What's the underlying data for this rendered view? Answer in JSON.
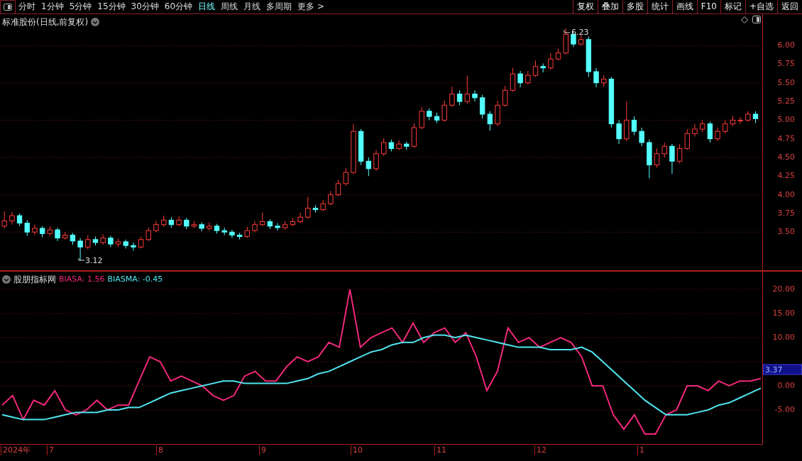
{
  "toolbar": {
    "periods": [
      {
        "label": "分时",
        "selected": false
      },
      {
        "label": "1分钟",
        "selected": false
      },
      {
        "label": "5分钟",
        "selected": false
      },
      {
        "label": "15分钟",
        "selected": false
      },
      {
        "label": "30分钟",
        "selected": false
      },
      {
        "label": "60分钟",
        "selected": false
      },
      {
        "label": "日线",
        "selected": true
      },
      {
        "label": "周线",
        "selected": false
      },
      {
        "label": "月线",
        "selected": false
      },
      {
        "label": "多周期",
        "selected": false
      },
      {
        "label": "更多 >",
        "selected": false
      }
    ],
    "buttons": [
      "复权",
      "叠加",
      "多股",
      "统计",
      "画线",
      "F10",
      "标记",
      "+自选",
      "返回"
    ]
  },
  "price_panel": {
    "title": "标准股份(日线,前复权)",
    "high_label": "6.23",
    "low_label": "3.12",
    "chart_data": {
      "type": "candlestick",
      "grid": true,
      "ylim": [
        2.97,
        6.42
      ],
      "yticks": [
        {
          "value": 6,
          "label": "6.00"
        },
        {
          "value": 5.75,
          "label": "5.75"
        },
        {
          "value": 5.5,
          "label": "5.50"
        },
        {
          "value": 5.25,
          "label": "5.25"
        },
        {
          "value": 5,
          "label": "5.00"
        },
        {
          "value": 4.75,
          "label": "4.75"
        },
        {
          "value": 4.5,
          "label": "4.50"
        },
        {
          "value": 4.25,
          "label": "4.25"
        },
        {
          "value": 4,
          "label": "4.00"
        },
        {
          "value": 3.75,
          "label": "3.75"
        },
        {
          "value": 3.5,
          "label": "3.50"
        }
      ],
      "ohlc": [
        [
          3.58,
          3.78,
          3.55,
          3.65
        ],
        [
          3.65,
          3.77,
          3.6,
          3.72
        ],
        [
          3.72,
          3.75,
          3.58,
          3.62
        ],
        [
          3.62,
          3.66,
          3.45,
          3.5
        ],
        [
          3.5,
          3.6,
          3.46,
          3.55
        ],
        [
          3.55,
          3.58,
          3.43,
          3.48
        ],
        [
          3.48,
          3.58,
          3.45,
          3.53
        ],
        [
          3.53,
          3.56,
          3.38,
          3.42
        ],
        [
          3.42,
          3.5,
          3.4,
          3.46
        ],
        [
          3.46,
          3.49,
          3.33,
          3.38
        ],
        [
          3.38,
          3.42,
          3.12,
          3.3
        ],
        [
          3.3,
          3.46,
          3.27,
          3.4
        ],
        [
          3.4,
          3.44,
          3.32,
          3.36
        ],
        [
          3.36,
          3.47,
          3.33,
          3.42
        ],
        [
          3.42,
          3.45,
          3.3,
          3.34
        ],
        [
          3.34,
          3.41,
          3.3,
          3.37
        ],
        [
          3.37,
          3.4,
          3.28,
          3.32
        ],
        [
          3.32,
          3.36,
          3.25,
          3.3
        ],
        [
          3.3,
          3.44,
          3.28,
          3.4
        ],
        [
          3.4,
          3.56,
          3.38,
          3.52
        ],
        [
          3.52,
          3.65,
          3.5,
          3.6
        ],
        [
          3.6,
          3.72,
          3.57,
          3.66
        ],
        [
          3.66,
          3.7,
          3.56,
          3.6
        ],
        [
          3.6,
          3.71,
          3.58,
          3.66
        ],
        [
          3.66,
          3.69,
          3.54,
          3.58
        ],
        [
          3.58,
          3.65,
          3.55,
          3.6
        ],
        [
          3.6,
          3.63,
          3.51,
          3.55
        ],
        [
          3.55,
          3.63,
          3.52,
          3.58
        ],
        [
          3.58,
          3.61,
          3.48,
          3.52
        ],
        [
          3.52,
          3.56,
          3.46,
          3.5
        ],
        [
          3.5,
          3.53,
          3.42,
          3.46
        ],
        [
          3.46,
          3.49,
          3.4,
          3.44
        ],
        [
          3.44,
          3.57,
          3.42,
          3.52
        ],
        [
          3.52,
          3.65,
          3.5,
          3.6
        ],
        [
          3.6,
          3.76,
          3.58,
          3.64
        ],
        [
          3.64,
          3.67,
          3.54,
          3.58
        ],
        [
          3.58,
          3.62,
          3.52,
          3.56
        ],
        [
          3.56,
          3.65,
          3.53,
          3.6
        ],
        [
          3.6,
          3.69,
          3.58,
          3.64
        ],
        [
          3.64,
          3.76,
          3.62,
          3.7
        ],
        [
          3.7,
          3.97,
          3.68,
          3.82
        ],
        [
          3.82,
          3.86,
          3.76,
          3.8
        ],
        [
          3.8,
          3.93,
          3.78,
          3.88
        ],
        [
          3.88,
          4.05,
          3.86,
          4.0
        ],
        [
          4.0,
          4.2,
          3.98,
          4.15
        ],
        [
          4.15,
          4.36,
          4.12,
          4.3
        ],
        [
          4.3,
          4.95,
          4.28,
          4.85
        ],
        [
          4.85,
          4.88,
          4.4,
          4.45
        ],
        [
          4.45,
          4.5,
          4.25,
          4.35
        ],
        [
          4.35,
          4.6,
          4.32,
          4.55
        ],
        [
          4.55,
          4.76,
          4.52,
          4.7
        ],
        [
          4.7,
          4.74,
          4.58,
          4.62
        ],
        [
          4.62,
          4.73,
          4.6,
          4.68
        ],
        [
          4.68,
          4.71,
          4.6,
          4.65
        ],
        [
          4.65,
          4.96,
          4.63,
          4.9
        ],
        [
          4.9,
          5.18,
          4.88,
          5.12
        ],
        [
          5.12,
          5.16,
          5.0,
          5.05
        ],
        [
          5.05,
          5.1,
          4.96,
          5.0
        ],
        [
          5.0,
          5.26,
          4.98,
          5.2
        ],
        [
          5.2,
          5.45,
          5.18,
          5.35
        ],
        [
          5.35,
          5.4,
          5.2,
          5.25
        ],
        [
          5.25,
          5.6,
          5.22,
          5.35
        ],
        [
          5.35,
          5.4,
          5.25,
          5.3
        ],
        [
          5.3,
          5.34,
          5.02,
          5.08
        ],
        [
          5.08,
          5.12,
          4.86,
          4.95
        ],
        [
          4.95,
          5.26,
          4.92,
          5.2
        ],
        [
          5.2,
          5.46,
          5.18,
          5.4
        ],
        [
          5.4,
          5.7,
          5.38,
          5.62
        ],
        [
          5.62,
          5.66,
          5.44,
          5.5
        ],
        [
          5.5,
          5.66,
          5.48,
          5.6
        ],
        [
          5.6,
          5.8,
          5.58,
          5.72
        ],
        [
          5.72,
          5.76,
          5.64,
          5.7
        ],
        [
          5.7,
          5.9,
          5.68,
          5.82
        ],
        [
          5.82,
          5.96,
          5.8,
          5.9
        ],
        [
          5.9,
          6.23,
          5.88,
          6.15
        ],
        [
          6.15,
          6.18,
          5.98,
          6.02
        ],
        [
          6.02,
          6.14,
          6.0,
          6.08
        ],
        [
          6.08,
          6.12,
          5.58,
          5.65
        ],
        [
          5.65,
          5.7,
          5.44,
          5.5
        ],
        [
          5.5,
          5.6,
          5.45,
          5.55
        ],
        [
          5.55,
          5.58,
          4.9,
          4.95
        ],
        [
          4.95,
          5.0,
          4.68,
          4.75
        ],
        [
          4.75,
          5.25,
          4.72,
          5.0
        ],
        [
          5.0,
          5.05,
          4.8,
          4.85
        ],
        [
          4.85,
          4.9,
          4.65,
          4.7
        ],
        [
          4.7,
          4.74,
          4.22,
          4.4
        ],
        [
          4.4,
          4.62,
          4.36,
          4.55
        ],
        [
          4.55,
          4.7,
          4.5,
          4.65
        ],
        [
          4.65,
          4.68,
          4.28,
          4.45
        ],
        [
          4.45,
          4.68,
          4.42,
          4.62
        ],
        [
          4.62,
          4.88,
          4.6,
          4.82
        ],
        [
          4.82,
          4.95,
          4.78,
          4.88
        ],
        [
          4.88,
          5.0,
          4.84,
          4.95
        ],
        [
          4.95,
          4.98,
          4.7,
          4.75
        ],
        [
          4.75,
          4.9,
          4.72,
          4.85
        ],
        [
          4.85,
          5.0,
          4.82,
          4.95
        ],
        [
          4.95,
          5.06,
          4.92,
          5.0
        ],
        [
          5.0,
          5.04,
          4.95,
          5.0
        ],
        [
          5.0,
          5.12,
          4.98,
          5.08
        ],
        [
          5.08,
          5.12,
          4.96,
          5.02
        ]
      ]
    }
  },
  "indicator_panel": {
    "title": "股朋指标网",
    "current_value": "3.37",
    "legend": [
      {
        "value": ": 1.56"
      },
      {
        "value": ": -0.45"
      }
    ],
    "chart_data": {
      "type": "line",
      "grid": true,
      "ylim": [
        -12.06,
        23.68
      ],
      "yticks": [
        {
          "value": 20,
          "label": "20.00"
        },
        {
          "value": 15,
          "label": "15.00"
        },
        {
          "value": 10,
          "label": "10.00"
        },
        {
          "value": 0,
          "label": "0.00"
        },
        {
          "value": -5,
          "label": "-5.00"
        }
      ],
      "series": [
        {
          "name": "BIASA",
          "color": "#f0287a",
          "values": [
            -4,
            -2,
            -7,
            -3,
            -4,
            -1,
            -5,
            -6,
            -5,
            -3,
            -5,
            -4,
            -4,
            1,
            6,
            5,
            1,
            2,
            1,
            0,
            -2,
            -3,
            -2,
            2,
            3,
            1,
            1,
            4,
            6,
            5,
            6,
            9,
            8,
            20,
            8,
            10,
            11,
            12,
            9,
            13,
            9,
            11,
            12,
            9,
            11,
            6,
            -1,
            3,
            12,
            9,
            10,
            8,
            9,
            10,
            9,
            6,
            0,
            0,
            -6,
            -9,
            -6,
            -10,
            -10,
            -6,
            -5,
            0,
            0,
            -1,
            1,
            0,
            1,
            1,
            1.5
          ]
        },
        {
          "name": "BIASMA",
          "color": "#50e6f0",
          "values": [
            -6,
            -6.5,
            -7,
            -7,
            -7,
            -6.5,
            -6,
            -5.5,
            -5.5,
            -5.5,
            -5,
            -5,
            -4.5,
            -4.5,
            -3.5,
            -2.5,
            -1.5,
            -1,
            -0.5,
            0,
            0.5,
            1,
            1,
            0.5,
            0.5,
            0.5,
            0.5,
            0.5,
            1,
            1.5,
            2.5,
            3,
            4,
            5,
            6,
            7,
            7.5,
            8.5,
            9,
            9,
            10,
            10.5,
            10.5,
            10,
            10.5,
            10,
            9.5,
            9,
            8.5,
            8,
            8,
            8,
            7.5,
            7.5,
            7.5,
            8,
            7,
            5,
            3,
            1,
            -1,
            -3,
            -4.5,
            -6,
            -6,
            -6,
            -5.5,
            -5,
            -4,
            -3.5,
            -2.5,
            -1.5,
            -0.5
          ]
        }
      ]
    }
  },
  "date_axis": [
    "2024年",
    "7",
    "8",
    "9",
    "10",
    "11",
    "12",
    "1"
  ]
}
